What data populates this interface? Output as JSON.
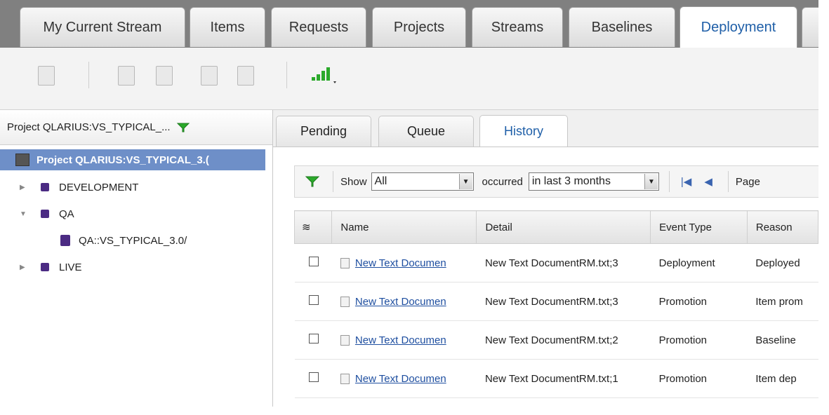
{
  "main_tabs": [
    {
      "label": "My Current Stream"
    },
    {
      "label": "Items"
    },
    {
      "label": "Requests"
    },
    {
      "label": "Projects"
    },
    {
      "label": "Streams"
    },
    {
      "label": "Baselines"
    },
    {
      "label": "Deployment",
      "active": true
    }
  ],
  "sidebar": {
    "header_label": "Project QLARIUS:VS_TYPICAL_...",
    "tree": [
      {
        "label": "Project QLARIUS:VS_TYPICAL_3.(",
        "selected": true
      },
      {
        "label": "DEVELOPMENT"
      },
      {
        "label": "QA"
      },
      {
        "label": "QA::VS_TYPICAL_3.0/"
      },
      {
        "label": "LIVE"
      }
    ]
  },
  "sub_tabs": [
    {
      "label": "Pending"
    },
    {
      "label": "Queue"
    },
    {
      "label": "History",
      "active": true
    }
  ],
  "filter": {
    "show_label": "Show",
    "show_value": "All",
    "occurred_label": "occurred",
    "occurred_value": "in last 3 months",
    "page_label": "Page"
  },
  "table": {
    "columns": [
      "Name",
      "Detail",
      "Event Type",
      "Reason"
    ],
    "rows": [
      {
        "name": "New Text Documen",
        "detail": "New Text DocumentRM.txt;3",
        "event": "Deployment",
        "reason": "Deployed"
      },
      {
        "name": "New Text Documen",
        "detail": "New Text DocumentRM.txt;3",
        "event": "Promotion",
        "reason": "Item prom"
      },
      {
        "name": "New Text Documen",
        "detail": "New Text DocumentRM.txt;2",
        "event": "Promotion",
        "reason": "Baseline"
      },
      {
        "name": "New Text Documen",
        "detail": "New Text DocumentRM.txt;1",
        "event": "Promotion",
        "reason": "Item dep"
      }
    ]
  },
  "colors": {
    "accent": "#1f5fa8",
    "tree_square": "#4b2b83",
    "filter_green": "#2aa92a"
  }
}
